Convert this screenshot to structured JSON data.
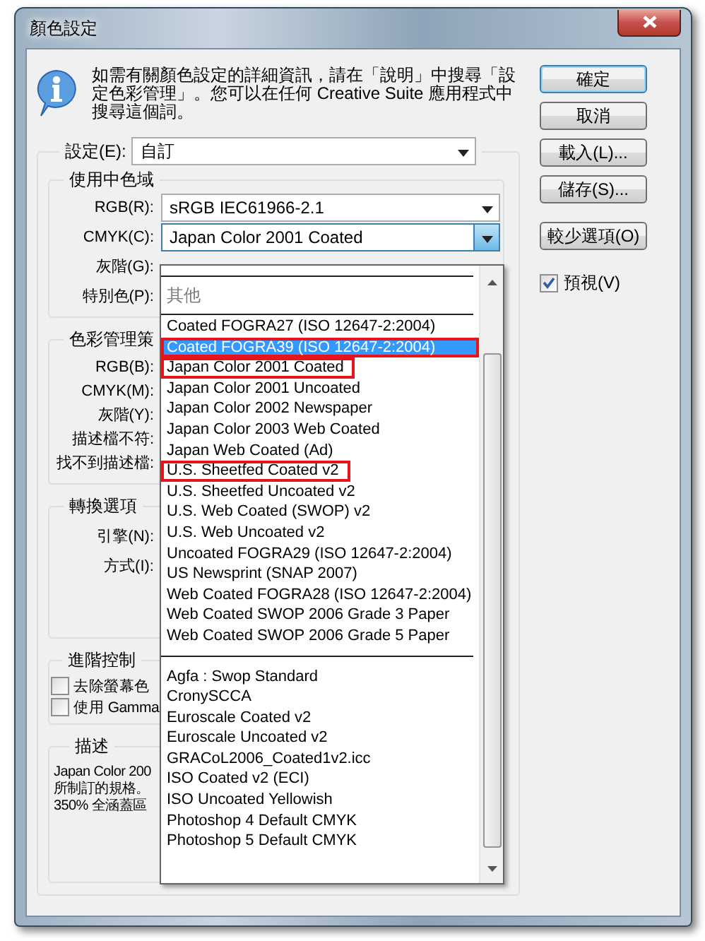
{
  "window": {
    "title": "顏色設定"
  },
  "info": {
    "lines": [
      "如需有關顏色設定的詳細資訊，請在「說明」中搜尋「設",
      "定色彩管理」。您可以在任何 Creative Suite 應用程式中",
      "搜尋這個詞。"
    ]
  },
  "settings": {
    "label": "設定(E):",
    "value": "自訂"
  },
  "working_spaces": {
    "title": "使用中色域",
    "fields": [
      {
        "label": "RGB(R):",
        "value": "sRGB IEC61966-2.1",
        "open": false
      },
      {
        "label": "CMYK(C):",
        "value": "Japan Color 2001 Coated",
        "open": true
      },
      {
        "label": "灰階(G):"
      },
      {
        "label": "特別色(P):"
      }
    ]
  },
  "policies": {
    "title": "色彩管理策",
    "fields": [
      {
        "label": "RGB(B):"
      },
      {
        "label": "CMYK(M):"
      },
      {
        "label": "灰階(Y):"
      },
      {
        "label": "描述檔不符:"
      },
      {
        "label": "找不到描述檔:"
      }
    ]
  },
  "conversion": {
    "title": "轉換選項",
    "fields": [
      {
        "label": "引擎(N):"
      },
      {
        "label": "方式(I):"
      }
    ]
  },
  "advanced": {
    "title": "進階控制",
    "checkboxes": [
      {
        "label": "去除螢幕色",
        "checked": false
      },
      {
        "label": "使用 Gamma",
        "checked": false
      }
    ]
  },
  "description": {
    "title": "描述",
    "lines": [
      "Japan Color 200",
      "所制訂的規格。",
      "350% 全涵蓋區"
    ]
  },
  "buttons": [
    {
      "label": "確定",
      "default": true
    },
    {
      "label": "取消",
      "default": false
    },
    {
      "label": "載入(L)...",
      "default": false
    },
    {
      "label": "儲存(S)...",
      "default": false
    },
    {
      "label": "較少選項(O)",
      "default": false
    }
  ],
  "preview": {
    "label": "預視(V)",
    "checked": true
  },
  "dropdown": {
    "group_label": "其他",
    "groups": [
      {
        "items": [
          {
            "label": "Coated FOGRA27 (ISO 12647-2:2004)",
            "selected": false,
            "highlighted": false
          },
          {
            "label": "Coated FOGRA39 (ISO 12647-2:2004)",
            "selected": true,
            "highlighted": true
          },
          {
            "label": "Japan Color 2001 Coated",
            "selected": false,
            "highlighted": true
          },
          {
            "label": "Japan Color 2001 Uncoated",
            "selected": false,
            "highlighted": false
          },
          {
            "label": "Japan Color 2002 Newspaper",
            "selected": false,
            "highlighted": false
          },
          {
            "label": "Japan Color 2003 Web Coated",
            "selected": false,
            "highlighted": false
          },
          {
            "label": "Japan Web Coated (Ad)",
            "selected": false,
            "highlighted": false
          },
          {
            "label": "U.S. Sheetfed Coated v2",
            "selected": false,
            "highlighted": true
          },
          {
            "label": "U.S. Sheetfed Uncoated v2",
            "selected": false,
            "highlighted": false
          },
          {
            "label": "U.S. Web Coated (SWOP) v2",
            "selected": false,
            "highlighted": false
          },
          {
            "label": "U.S. Web Uncoated v2",
            "selected": false,
            "highlighted": false
          },
          {
            "label": "Uncoated FOGRA29 (ISO 12647-2:2004)",
            "selected": false,
            "highlighted": false
          },
          {
            "label": "US Newsprint (SNAP 2007)",
            "selected": false,
            "highlighted": false
          },
          {
            "label": "Web Coated FOGRA28 (ISO 12647-2:2004)",
            "selected": false,
            "highlighted": false
          },
          {
            "label": "Web Coated SWOP 2006 Grade 3 Paper",
            "selected": false,
            "highlighted": false
          },
          {
            "label": "Web Coated SWOP 2006 Grade 5 Paper",
            "selected": false,
            "highlighted": false
          }
        ]
      },
      {
        "items": [
          {
            "label": "Agfa : Swop Standard",
            "selected": false,
            "highlighted": false
          },
          {
            "label": "CronySCCA",
            "selected": false,
            "highlighted": false
          },
          {
            "label": "Euroscale Coated v2",
            "selected": false,
            "highlighted": false
          },
          {
            "label": "Euroscale Uncoated v2",
            "selected": false,
            "highlighted": false
          },
          {
            "label": "GRACoL2006_Coated1v2.icc",
            "selected": false,
            "highlighted": false
          },
          {
            "label": "ISO Coated v2 (ECI)",
            "selected": false,
            "highlighted": false
          },
          {
            "label": "ISO Uncoated Yellowish",
            "selected": false,
            "highlighted": false
          },
          {
            "label": "Photoshop 4 Default CMYK",
            "selected": false,
            "highlighted": false
          },
          {
            "label": "Photoshop 5 Default CMYK",
            "selected": false,
            "highlighted": false
          }
        ]
      }
    ]
  }
}
